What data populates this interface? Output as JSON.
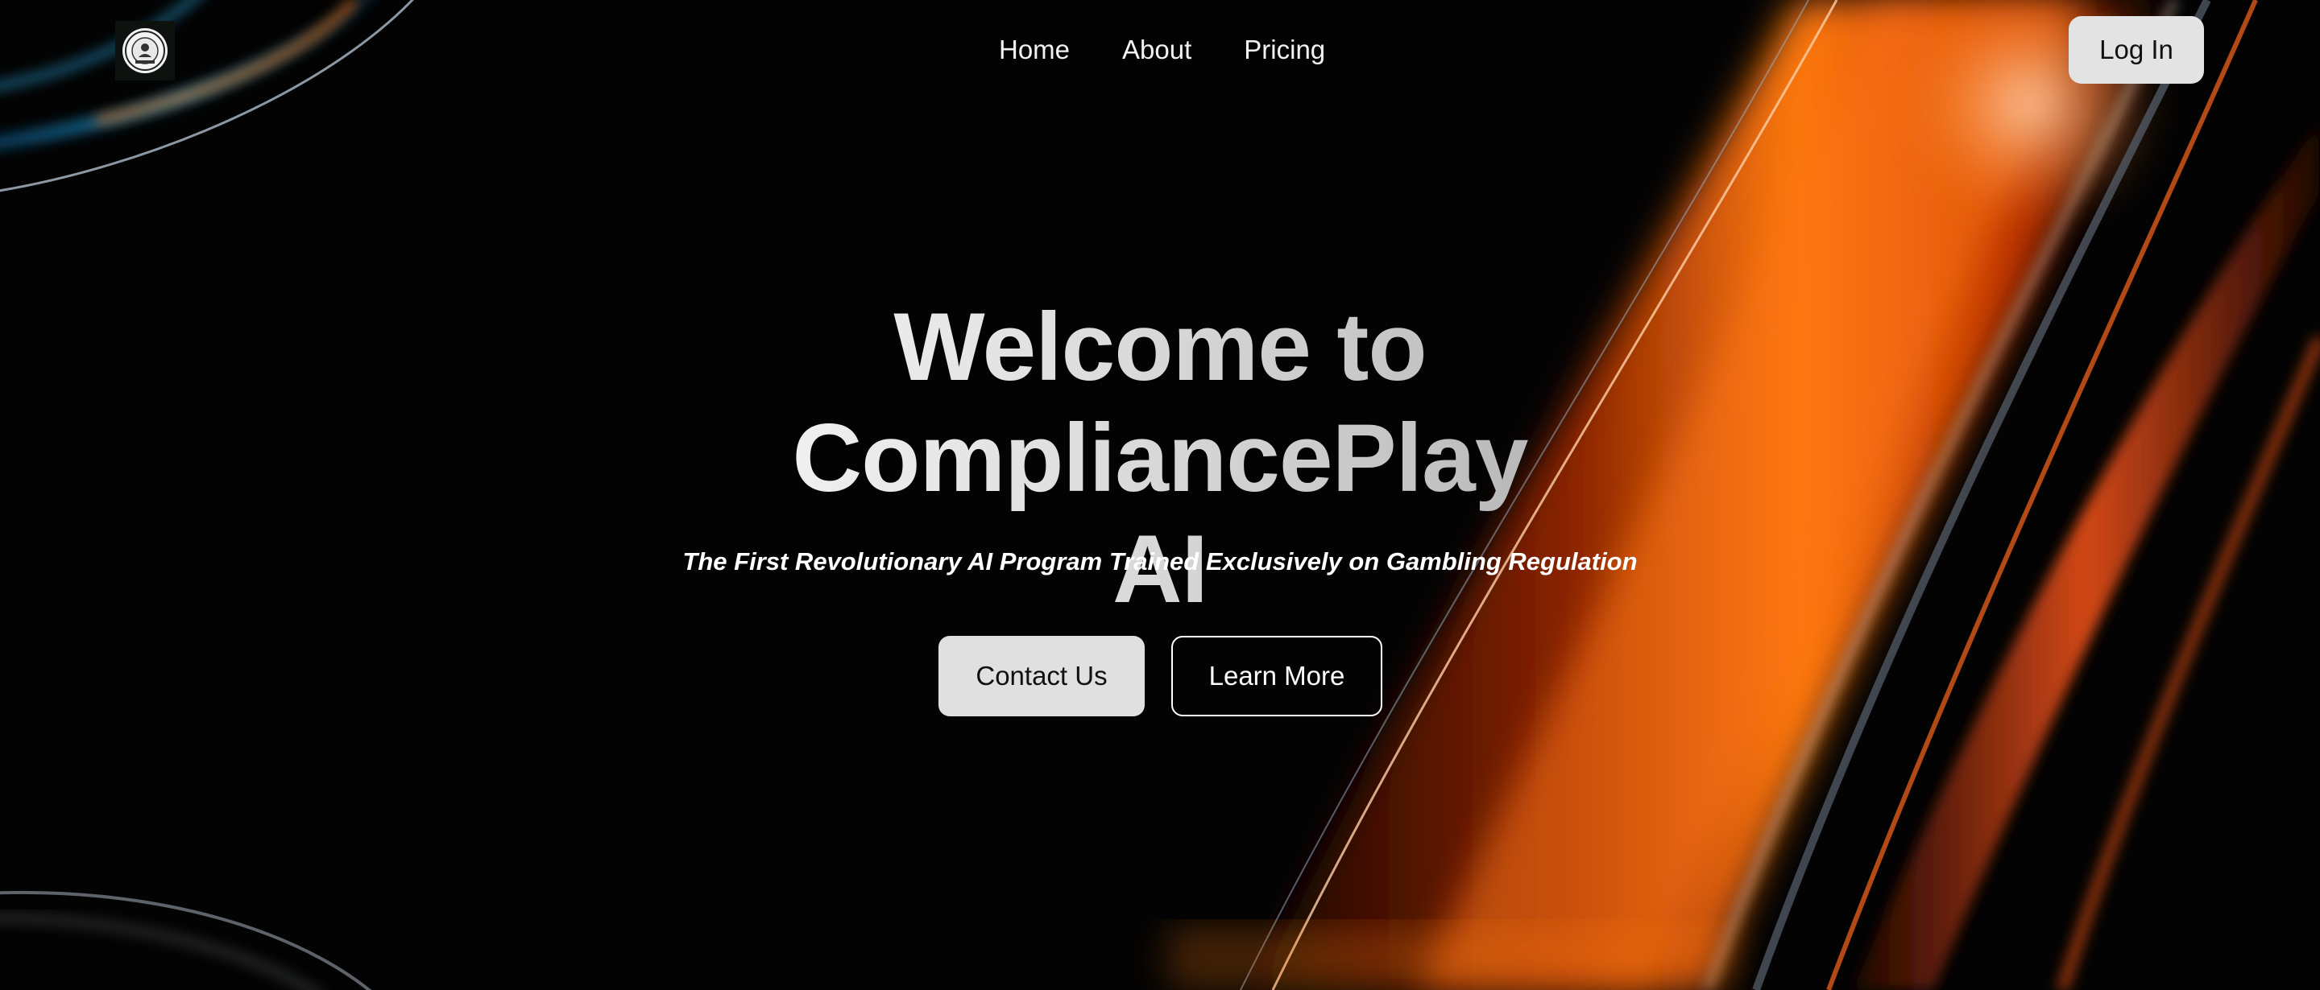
{
  "nav": {
    "logo_alt": "CompliancePlay AI logo",
    "links": [
      {
        "label": "Home"
      },
      {
        "label": "About"
      },
      {
        "label": "Pricing"
      }
    ],
    "login_label": "Log In"
  },
  "hero": {
    "title_line1": "Welcome to CompliancePlay",
    "title_line2": "AI",
    "subtitle": "The First Revolutionary AI Program Trained Exclusively on Gambling Regulation",
    "contact_label": "Contact Us",
    "learn_more_label": "Learn More"
  },
  "colors": {
    "background": "#000000",
    "accent_orange": "#ff6a00",
    "accent_blue": "#2aa8e0",
    "button_light": "#e0e0e0"
  }
}
